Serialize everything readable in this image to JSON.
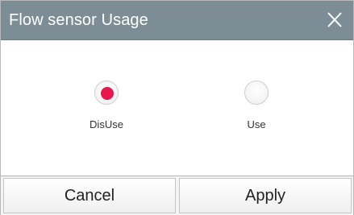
{
  "dialog": {
    "title": "Flow sensor Usage",
    "close_icon": "close-icon"
  },
  "options": [
    {
      "label": "DisUse",
      "selected": true
    },
    {
      "label": "Use",
      "selected": false
    }
  ],
  "footer": {
    "cancel_label": "Cancel",
    "apply_label": "Apply"
  },
  "colors": {
    "titlebar": "#7d8d95",
    "radio_selected": "#e8174b",
    "background": "#ffffff"
  }
}
